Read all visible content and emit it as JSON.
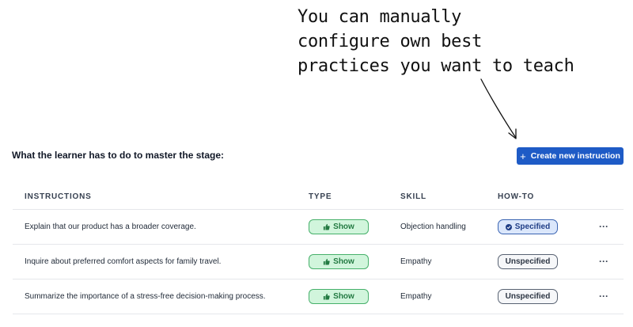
{
  "annotation": {
    "lines": [
      "You can manually",
      "configure own best",
      "practices you want to teach"
    ]
  },
  "section": {
    "title": "What the learner has to do to master the stage:"
  },
  "create_button": {
    "icon": "plus-icon",
    "label": "Create new instruction",
    "color": "#1e5bc6"
  },
  "table": {
    "headers": {
      "instructions": "INSTRUCTIONS",
      "type": "TYPE",
      "skill": "SKILL",
      "howto": "HOW-TO"
    },
    "rows": [
      {
        "instruction": "Explain that our product has a broader coverage.",
        "type": "Show",
        "skill": "Objection handling",
        "howto": "Specified",
        "more": "···"
      },
      {
        "instruction": "Inquire about preferred comfort aspects for family travel.",
        "type": "Show",
        "skill": "Empathy",
        "howto": "Unspecified",
        "more": "···"
      },
      {
        "instruction": "Summarize the importance of a stress-free decision-making process.",
        "type": "Show",
        "skill": "Empathy",
        "howto": "Unspecified",
        "more": "···"
      }
    ]
  },
  "colors": {
    "type_pill_bg": "#d1f5dc",
    "type_pill_border": "#46b06a",
    "specified_bg": "#dbe7fb",
    "specified_border": "#3a64b2",
    "unspecified_border": "#586272"
  }
}
